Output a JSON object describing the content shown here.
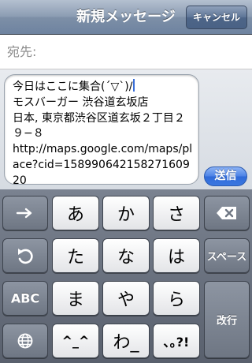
{
  "navbar": {
    "title": "新規メッセージ",
    "cancel_label": "キャンセル"
  },
  "to_field": {
    "label": "宛先:"
  },
  "compose": {
    "message": "今日はここに集合(´▽`)/\nモスバーガー 渋谷道玄坂店\n日本, 東京都渋谷区道玄坂２丁目２９−８\nhttp://maps.google.com/maps/place?cid=15899064215827160920",
    "send_label": "送信"
  },
  "keyboard": {
    "rows": [
      [
        "あ",
        "か",
        "さ"
      ],
      [
        "た",
        "な",
        "は"
      ],
      [
        "ま",
        "や",
        "ら"
      ],
      [
        "^_^",
        "わ_",
        "､｡?!"
      ]
    ],
    "space_label": "スペース",
    "abc_label": "ABC",
    "return_label": "改行",
    "icons": {
      "next": "arrow-right-icon",
      "undo": "undo-icon",
      "globe": "globe-icon",
      "delete": "delete-backspace-icon"
    }
  },
  "colors": {
    "send_button": "#3a77e0",
    "navbar": "#7d8fa7",
    "caret": "#3a6fd8"
  }
}
